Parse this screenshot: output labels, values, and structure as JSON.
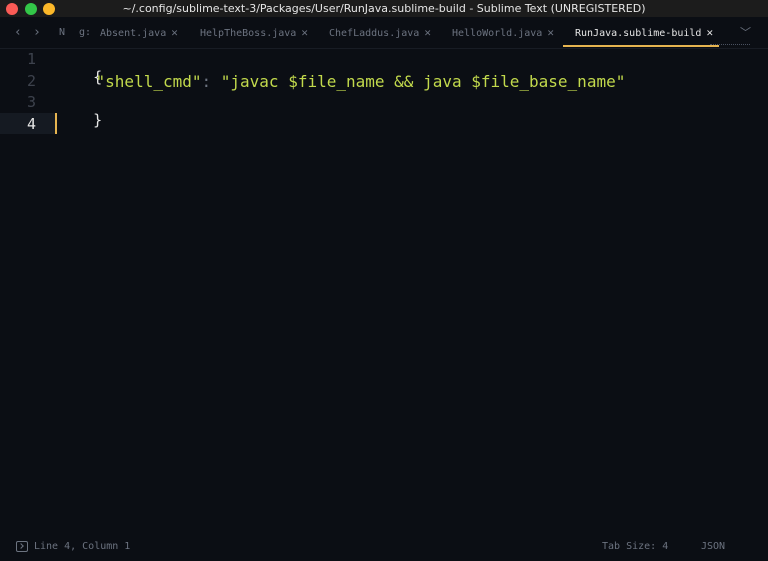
{
  "window": {
    "title": "~/.config/sublime-text-3/Packages/User/RunJava.sublime-build - Sublime Text (UNREGISTERED)"
  },
  "tabs": [
    {
      "label": "N",
      "close": ""
    },
    {
      "label": "g:",
      "close": ""
    },
    {
      "label": "Absent.java",
      "close": "✕"
    },
    {
      "label": "HelpTheBoss.java",
      "close": "✕"
    },
    {
      "label": "ChefLaddus.java",
      "close": "✕"
    },
    {
      "label": "HelloWorld.java",
      "close": "✕"
    },
    {
      "label": "RunJava.sublime-build",
      "close": "✕",
      "active": true
    }
  ],
  "editor": {
    "line_numbers": [
      "1",
      "2",
      "3",
      "4"
    ],
    "lines": {
      "open_brace": "{",
      "indent": "    ",
      "key": "\"shell_cmd\"",
      "colon": ": ",
      "value": "\"javac $file_name && java $file_base_name\"",
      "close_brace": "}"
    }
  },
  "status": {
    "position": "Line 4, Column 1",
    "tab_size": "Tab Size: 4",
    "syntax": "JSON"
  },
  "colors": {
    "background": "#0b0e14",
    "accent": "#e6b450",
    "string": "#c2d94c"
  }
}
